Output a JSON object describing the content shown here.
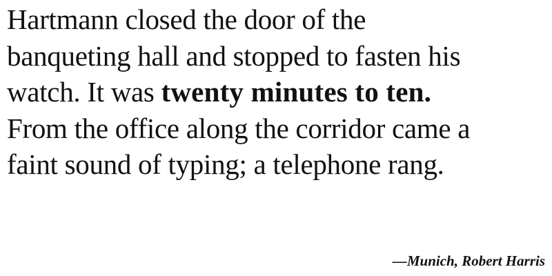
{
  "quote": {
    "line1": "Hartmann closed the door of the",
    "line2": "banqueting hall and stopped to fasten his",
    "line3_pre": "watch. It was ",
    "line3_bold": "twenty minutes to ten.",
    "line4": "From the office along the corridor came a",
    "line5": "faint sound of typing; a telephone rang."
  },
  "attribution": "—Munich, Robert Harris"
}
